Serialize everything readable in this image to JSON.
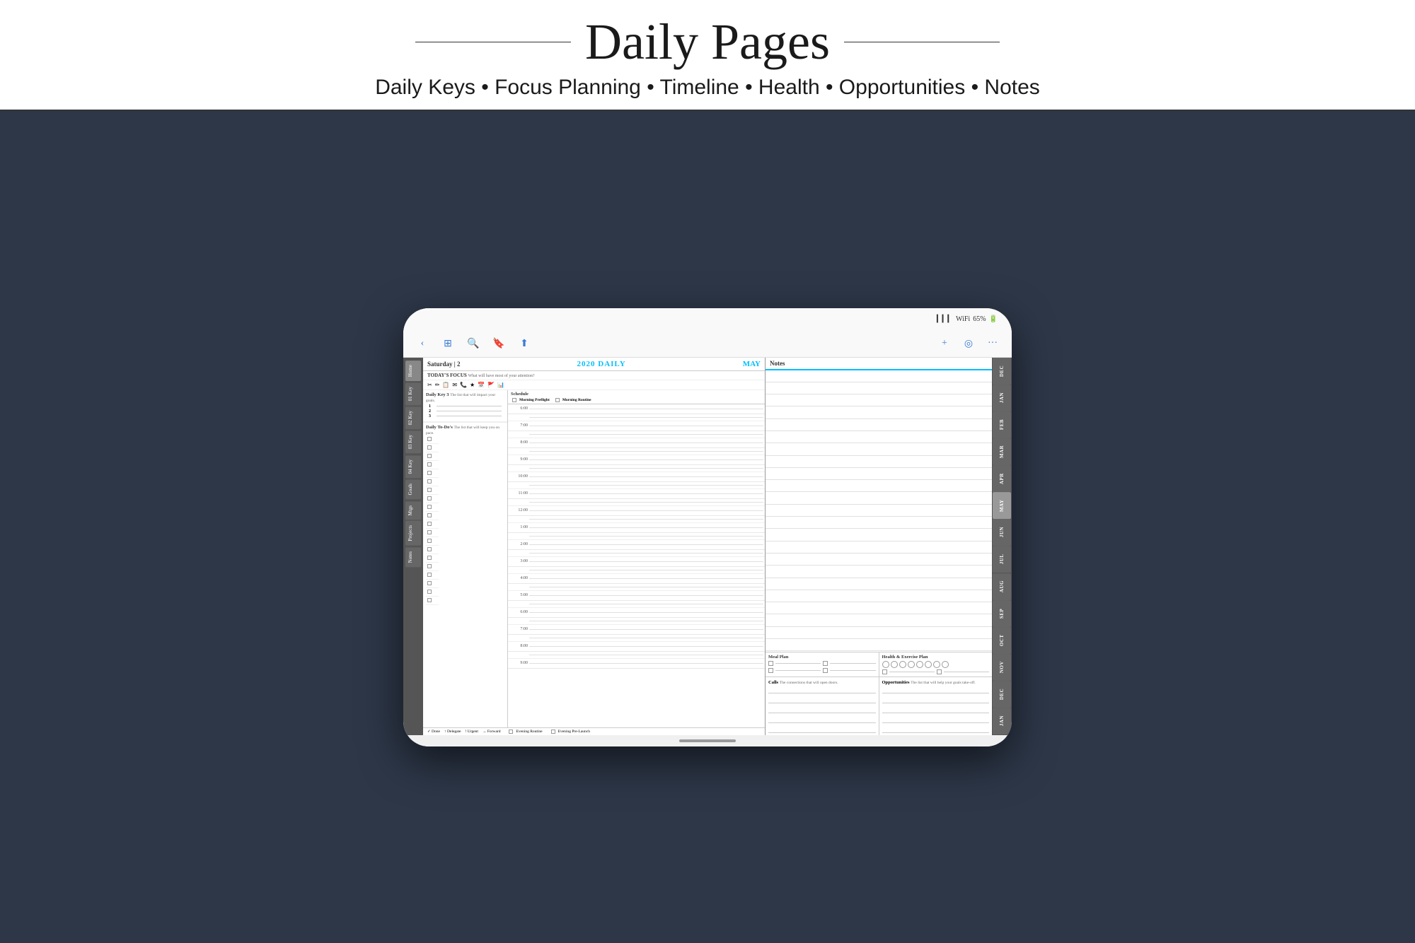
{
  "header": {
    "title": "Daily Pages",
    "subtitle": "Daily Keys • Focus Planning • Timeline • Health • Opportunities • Notes",
    "line_left": "—",
    "line_right": "—"
  },
  "tablet": {
    "status_bar": {
      "signal": "▎▎▎",
      "wifi": "WiFi",
      "battery": "65%"
    },
    "toolbar": {
      "back_icon": "‹",
      "grid_icon": "⊞",
      "search_icon": "🔍",
      "bookmark_icon": "🔖",
      "share_icon": "↑",
      "plus_icon": "+",
      "circle_icon": "◎",
      "more_icon": "···"
    },
    "planner": {
      "date": "Saturday | 2",
      "year": "2020 DAILY",
      "month": "MAY",
      "today_focus_label": "TODAY'S FOCUS",
      "today_focus_sub": "What will have most of your attention?",
      "section_keys_label": "Daily Key 3",
      "section_keys_sub": "The list that will impact your goals.",
      "schedule_label": "Schedule",
      "morning_preflight": "Morning Preflight",
      "morning_routine": "Morning Routine",
      "todo_label": "Daily To-Do's",
      "todo_sub": "The list that will keep you on pace.",
      "times": [
        "6:00",
        "7:00",
        "8:00",
        "9:00",
        "10:00",
        "11:00",
        "12:00",
        "1:00",
        "2:00",
        "3:00",
        "4:00",
        "5:00",
        "6:00",
        "7:00",
        "8:00",
        "9:00"
      ],
      "footer_legend": [
        "✓ Done",
        "↑ Delegate",
        "! Urgent",
        "→ Forward"
      ],
      "evening_routine": "Evening Routine",
      "evening_prelaunch": "Evening Pre-Launch",
      "notes_title": "Notes",
      "meal_plan_label": "Meal Plan",
      "health_exercise_label": "Health & Exercise Plan",
      "calls_label": "Calls",
      "calls_sub": "The connections that will open doors.",
      "opportunities_label": "Opportunities",
      "opportunities_sub": "The list that will help your goals take-off."
    },
    "sidebar_left": [
      "Home",
      "01 Key",
      "02 Key",
      "03 Key",
      "04 Key",
      "Goals",
      "Mtgs",
      "Projects",
      "Notes"
    ],
    "sidebar_right": [
      "DEC",
      "JAN",
      "FEB",
      "MAR",
      "APR",
      "MAY",
      "JUN",
      "JUL",
      "AUG",
      "SEP",
      "OCT",
      "NOV",
      "DEC",
      "JAN"
    ]
  }
}
